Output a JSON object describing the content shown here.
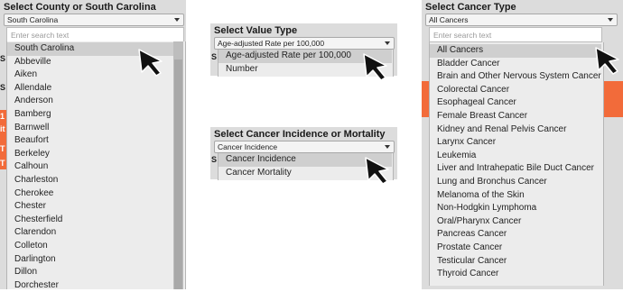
{
  "county": {
    "header": "Select County or South Carolina",
    "selected": "South Carolina",
    "search_placeholder": "Enter search text",
    "options": [
      "South Carolina",
      "Abbeville",
      "Aiken",
      "Allendale",
      "Anderson",
      "Bamberg",
      "Barnwell",
      "Beaufort",
      "Berkeley",
      "Calhoun",
      "Charleston",
      "Cherokee",
      "Chester",
      "Chesterfield",
      "Clarendon",
      "Colleton",
      "Darlington",
      "Dillon",
      "Dorchester"
    ]
  },
  "value_type": {
    "header": "Select Value Type",
    "selected": "Age-adjusted Rate per 100,000",
    "options": [
      "Age-adjusted Rate per 100,000",
      "Number"
    ]
  },
  "incidence": {
    "header": "Select Cancer Incidence or Mortality",
    "selected": "Cancer Incidence",
    "options": [
      "Cancer Incidence",
      "Cancer Mortality"
    ]
  },
  "cancer_type": {
    "header": "Select Cancer Type",
    "selected": "All Cancers",
    "search_placeholder": "Enter search text",
    "options": [
      "All Cancers",
      "Bladder Cancer",
      "Brain and Other Nervous System Cancer",
      "Colorectal Cancer",
      "Esophageal Cancer",
      "Female Breast Cancer",
      "Kidney and Renal Pelvis Cancer",
      "Larynx Cancer",
      "Leukemia",
      "Liver and Intrahepatic Bile Duct Cancer",
      "Lung and Bronchus Cancer",
      "Melanoma of the Skin",
      "Non-Hodgkin Lymphoma",
      "Oral/Pharynx Cancer",
      "Pancreas Cancer",
      "Prostate Cancer",
      "Testicular Cancer",
      "Thyroid Cancer"
    ]
  },
  "colors": {
    "accent_orange": "#f26b3a",
    "panel_gray": "#dcdcdc",
    "selected_row": "#cfcfcf"
  },
  "icons": {
    "pointer": "mouse-pointer-icon",
    "caret": "chevron-down-icon"
  }
}
